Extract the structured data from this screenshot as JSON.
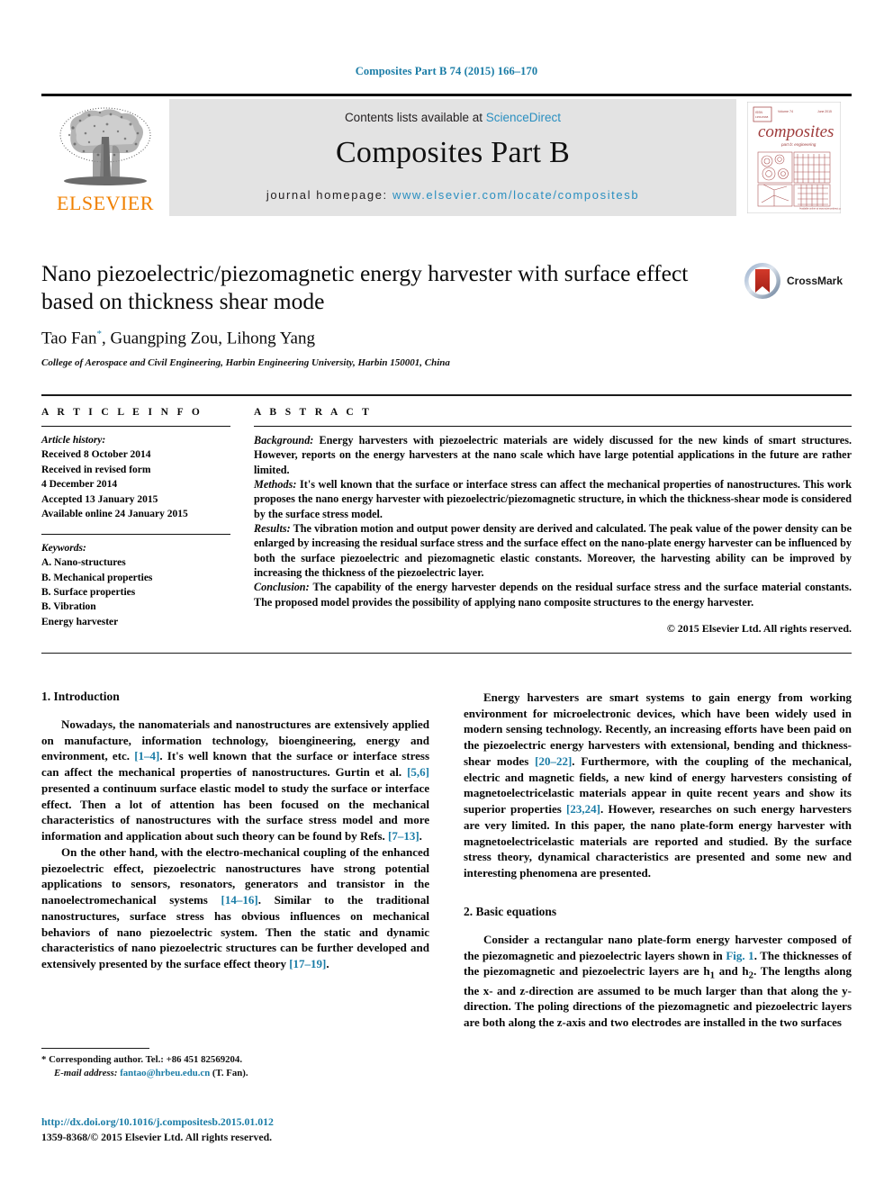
{
  "running_head": "Composites Part B 74 (2015) 166–170",
  "masthead": {
    "contents_prefix": "Contents lists available at ",
    "sciencedirect": "ScienceDirect",
    "journal_title": "Composites Part B",
    "homepage_prefix": "journal homepage: ",
    "homepage_url": "www.elsevier.com/locate/compositesb",
    "publisher_wordmark": "ELSEVIER",
    "cover_title": "composites",
    "cover_subtitle": "part b: engineering"
  },
  "article": {
    "title": "Nano piezoelectric/piezomagnetic energy harvester with surface effect based on thickness shear mode",
    "authors": "Tao Fan, Guangping Zou, Lihong Yang",
    "author_marker": "*",
    "affiliation": "College of Aerospace and Civil Engineering, Harbin Engineering University, Harbin 150001, China",
    "crossmark_label": "CrossMark"
  },
  "article_info": {
    "heading": "A R T I C L E   I N F O",
    "history_label": "Article history:",
    "history": [
      "Received 8 October 2014",
      "Received in revised form",
      "4 December 2014",
      "Accepted 13 January 2015",
      "Available online 24 January 2015"
    ],
    "keywords_label": "Keywords:",
    "keywords": [
      "A. Nano-structures",
      "B. Mechanical properties",
      "B. Surface properties",
      "B. Vibration",
      "Energy harvester"
    ]
  },
  "abstract": {
    "heading": "A B S T R A C T",
    "background_label": "Background:",
    "background_text": " Energy harvesters with piezoelectric materials are widely discussed for the new kinds of smart structures. However, reports on the energy harvesters at the nano scale which have large potential applications in the future are rather limited.",
    "methods_label": "Methods:",
    "methods_text": " It's well known that the surface or interface stress can affect the mechanical properties of nanostructures. This work proposes the nano energy harvester with piezoelectric/piezomagnetic structure, in which the thickness-shear mode is considered by the surface stress model.",
    "results_label": "Results:",
    "results_text": " The vibration motion and output power density are derived and calculated. The peak value of the power density can be enlarged by increasing the residual surface stress and the surface effect on the nano-plate energy harvester can be influenced by both the surface piezoelectric and piezomagnetic elastic constants. Moreover, the harvesting ability can be improved by increasing the thickness of the piezoelectric layer.",
    "conclusion_label": "Conclusion:",
    "conclusion_text": " The capability of the energy harvester depends on the residual surface stress and the surface material constants. The proposed model provides the possibility of applying nano composite structures to the energy harvester.",
    "copyright": "© 2015 Elsevier Ltd. All rights reserved."
  },
  "sections": {
    "intro_heading": "1. Introduction",
    "basic_eq_heading": "2. Basic equations"
  },
  "body": {
    "left_p1_a": "Nowadays, the nanomaterials and nanostructures are extensively applied on manufacture, information technology, bioengineering, energy and environment, etc. ",
    "left_p1_ref1": "[1–4]",
    "left_p1_b": ". It's well known that the surface or interface stress can affect the mechanical properties of nanostructures. Gurtin et al. ",
    "left_p1_ref2": "[5,6]",
    "left_p1_c": " presented a continuum surface elastic model to study the surface or interface effect. Then a lot of attention has been focused on the mechanical characteristics of nanostructures with the surface stress model and more information and application about such theory can be found by Refs. ",
    "left_p1_ref3": "[7–13]",
    "left_p1_d": ".",
    "left_p2_a": "On the other hand, with the electro-mechanical coupling of the enhanced piezoelectric effect, piezoelectric nanostructures have strong potential applications to sensors, resonators, generators and transistor in the nanoelectromechanical systems ",
    "left_p2_ref1": "[14–16]",
    "left_p2_b": ". Similar to the traditional nanostructures, surface stress has obvious influences on mechanical behaviors of nano piezoelectric system. Then the static and dynamic characteristics of nano piezoelectric structures can be further developed and extensively presented by the surface effect theory ",
    "left_p2_ref2": "[17–19]",
    "left_p2_c": ".",
    "right_p1_a": "Energy harvesters are smart systems to gain energy from working environment for microelectronic devices, which have been widely used in modern sensing technology. Recently, an increasing efforts have been paid on the piezoelectric energy harvesters with extensional, bending and thickness-shear modes ",
    "right_p1_ref1": "[20–22]",
    "right_p1_b": ". Furthermore, with the coupling of the mechanical, electric and magnetic fields, a new kind of energy harvesters consisting of magnetoelectricelastic materials appear in quite recent years and show its superior properties ",
    "right_p1_ref2": "[23,24]",
    "right_p1_c": ". However, researches on such energy harvesters are very limited. In this paper, the nano plate-form energy harvester with magnetoelectricelastic materials are reported and studied. By the surface stress theory, dynamical characteristics are presented and some new and interesting phenomena are presented.",
    "right_p2_a": "Consider a rectangular nano plate-form energy harvester composed of the piezomagnetic and piezoelectric layers shown in ",
    "right_p2_fig": "Fig. 1",
    "right_p2_b": ". The thicknesses of the piezomagnetic and piezoelectric layers are h",
    "right_p2_sub1": "1",
    "right_p2_c": " and h",
    "right_p2_sub2": "2",
    "right_p2_d": ". The lengths along the x- and z-direction are assumed to be much larger than that along the y-direction. The poling directions of the piezomagnetic and piezoelectric layers are both along the z-axis and two electrodes are installed in the two surfaces"
  },
  "footer": {
    "corresponding": "* Corresponding author. Tel.: +86 451 82569204.",
    "email_label": "E-mail address:",
    "email": "fantao@hrbeu.edu.cn",
    "email_suffix": " (T. Fan).",
    "doi": "http://dx.doi.org/10.1016/j.compositesb.2015.01.012",
    "issn": "1359-8368/© 2015 Elsevier Ltd. All rights reserved."
  },
  "colors": {
    "link": "#1a7ca6",
    "elsevier_orange": "#f08000",
    "band_gray": "#e3e3e3",
    "cover_red": "#9e3b3b"
  }
}
